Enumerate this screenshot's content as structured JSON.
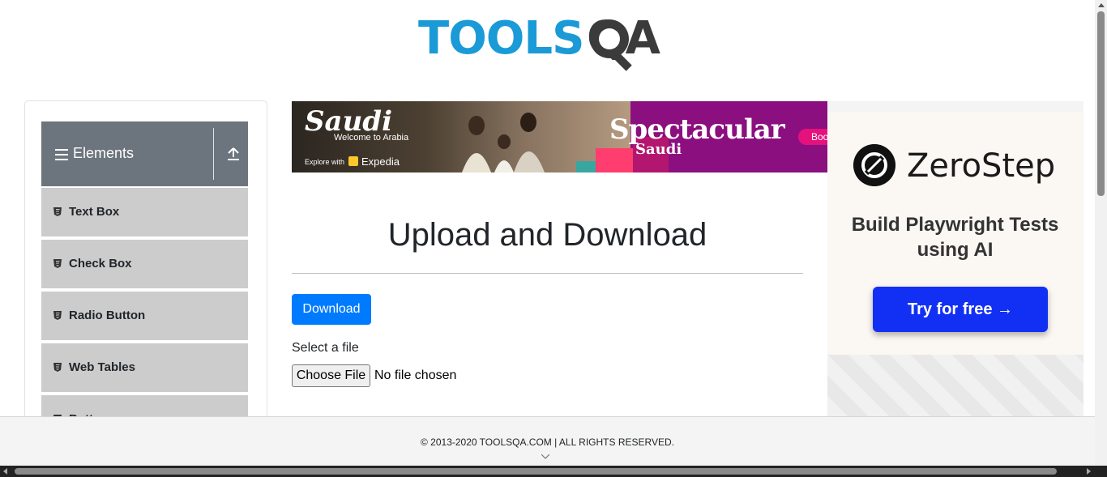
{
  "logo": {
    "part1": "TOOLS",
    "part2": "QA"
  },
  "sidebar": {
    "group_title": "Elements",
    "items": [
      {
        "label": "Text Box"
      },
      {
        "label": "Check Box"
      },
      {
        "label": "Radio Button"
      },
      {
        "label": "Web Tables"
      },
      {
        "label": "Butto"
      }
    ]
  },
  "banner": {
    "brand": "Saudi",
    "welcome": "Welcome to Arabia",
    "explore": "Explore with",
    "partner": "Expedia",
    "headline": "Spectacular",
    "subhead": "Saudi",
    "cta": "Boo"
  },
  "main": {
    "title": "Upload and Download",
    "download_label": "Download",
    "select_label": "Select a file",
    "choose_label": "Choose File",
    "no_file": "No file chosen"
  },
  "ad": {
    "brand": "ZeroStep",
    "tagline": "Build Playwright Tests using AI",
    "cta": "Try for free →"
  },
  "footer": {
    "text": "© 2013-2020 TOOLSQA.COM | ALL RIGHTS RESERVED."
  },
  "colors": {
    "brand_blue": "#1a9ad6",
    "primary": "#007bff",
    "sidebar_header": "#6c757d",
    "ad_cta": "#1230f4"
  }
}
